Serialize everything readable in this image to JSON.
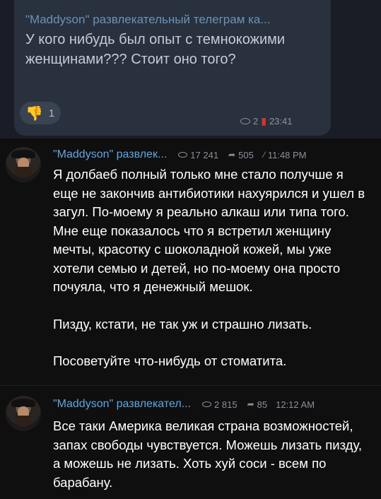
{
  "pinned": {
    "from": "\"Maddyson\" развлекательный телеграм ка...",
    "text": "У кого нибудь был опыт с темнокожими женщинами??? Стоит оно того?",
    "reaction_emoji": "👎",
    "reaction_count": "1",
    "views": "2",
    "time": "23:41"
  },
  "messages": [
    {
      "name": "\"Maddyson\" развлек...",
      "views": "17 241",
      "forwards": "505",
      "time": "11:48 PM",
      "paragraphs": [
        "Я долбаеб полный только мне стало получше я еще не закончив антибиотики нахуярился и ушел в загул. По-моему я реально алкаш или типа того. Мне еще показалось что я встретил женщину мечты, красотку с шоколадной кожей, мы уже хотели семью и детей, но по-моему она просто почуяла, что я денежный мешок.",
        "Пизду, кстати, не так уж и страшно лизать.",
        "Посоветуйте что-нибудь от стоматита."
      ]
    },
    {
      "name": "\"Maddyson\" развлекател...",
      "views": "2 815",
      "forwards": "85",
      "time": "12:12 AM",
      "paragraphs": [
        "Все таки Америка великая страна возможностей, запах свободы чувствуется. Можешь лизать пизду, а можешь не лизать. Хоть хуй соси - всем по барабану."
      ]
    }
  ],
  "icons": {
    "eye": "eye-icon",
    "share": "share-arrow-icon",
    "pin": "pin-icon",
    "avatar": "channel-avatar"
  },
  "colors": {
    "background": "#0f0f10",
    "name": "#5fa6e0",
    "meta": "#8a8f98",
    "pin": "#d9342b"
  }
}
